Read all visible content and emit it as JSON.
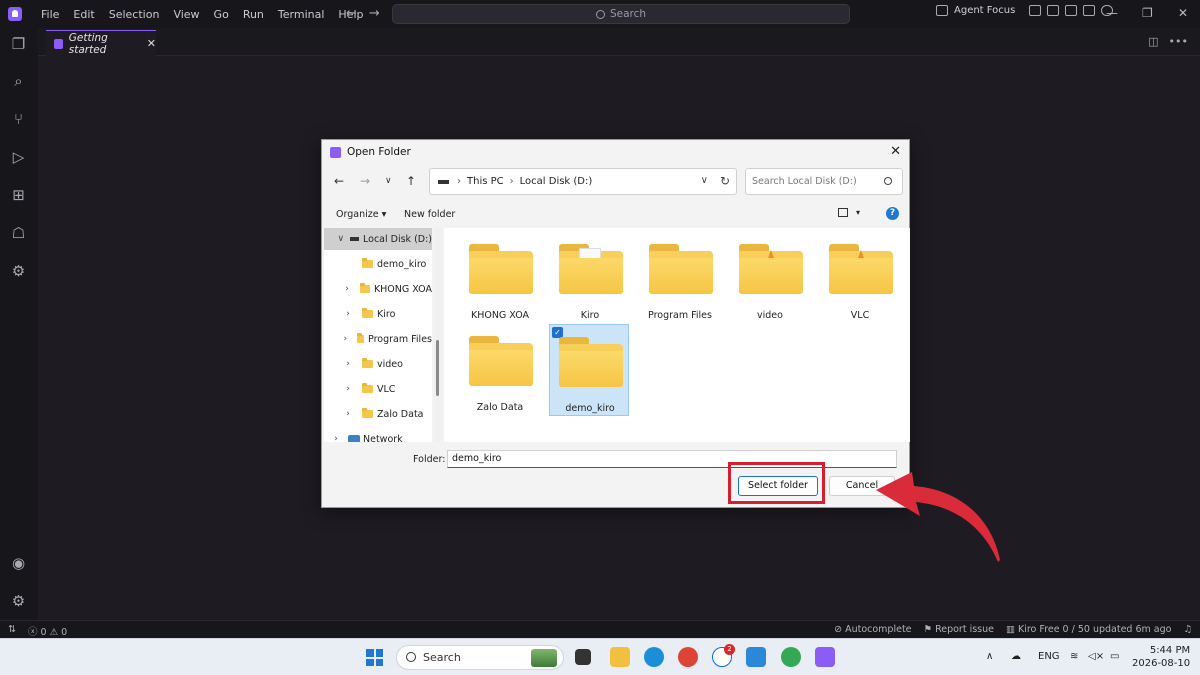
{
  "window": {
    "menu": [
      "File",
      "Edit",
      "Selection",
      "View",
      "Go",
      "Run",
      "Terminal",
      "Help"
    ],
    "search_placeholder": "Search",
    "agent_focus": "Agent Focus"
  },
  "tab": {
    "label": "Getting started"
  },
  "status": {
    "errors": "0",
    "warnings": "0",
    "autocomplete": "Autocomplete",
    "report_issue": "Report issue",
    "plan": "Kiro Free 0 / 50 updated 6m ago"
  },
  "dialog": {
    "title": "Open Folder",
    "breadcrumb": [
      "This PC",
      "Local Disk (D:)"
    ],
    "search_placeholder": "Search Local Disk (D:)",
    "organize": "Organize ▾",
    "new_folder": "New folder",
    "nav_items": [
      {
        "label": "Local Disk (D:)",
        "expanded": true,
        "selected": true
      },
      {
        "label": "demo_kiro"
      },
      {
        "label": "KHONG XOA"
      },
      {
        "label": "Kiro"
      },
      {
        "label": "Program Files"
      },
      {
        "label": "video"
      },
      {
        "label": "VLC"
      },
      {
        "label": "Zalo Data"
      },
      {
        "label": "Network"
      }
    ],
    "folders": [
      {
        "label": "KHONG XOA",
        "overlay": "drive-icon"
      },
      {
        "label": "Kiro",
        "overlay": "document-icon"
      },
      {
        "label": "Program Files",
        "overlay": ""
      },
      {
        "label": "video",
        "overlay": "vlc-cone-icon"
      },
      {
        "label": "VLC",
        "overlay": "vlc-cone-icon"
      },
      {
        "label": "Zalo Data",
        "overlay": ""
      },
      {
        "label": "demo_kiro",
        "overlay": "",
        "selected": true
      }
    ],
    "folder_field_label": "Folder:",
    "folder_field_value": "demo_kiro",
    "select_button": "Select folder",
    "cancel_button": "Cancel"
  },
  "taskbar": {
    "search_placeholder": "Search",
    "zalo_badge": "2",
    "lang": "ENG",
    "time": "5:44 PM",
    "date": "2026-08-10"
  },
  "colors": {
    "accent": "#8b5cf6",
    "highlight": "#d4202e",
    "folder": "#f7cf5a"
  }
}
